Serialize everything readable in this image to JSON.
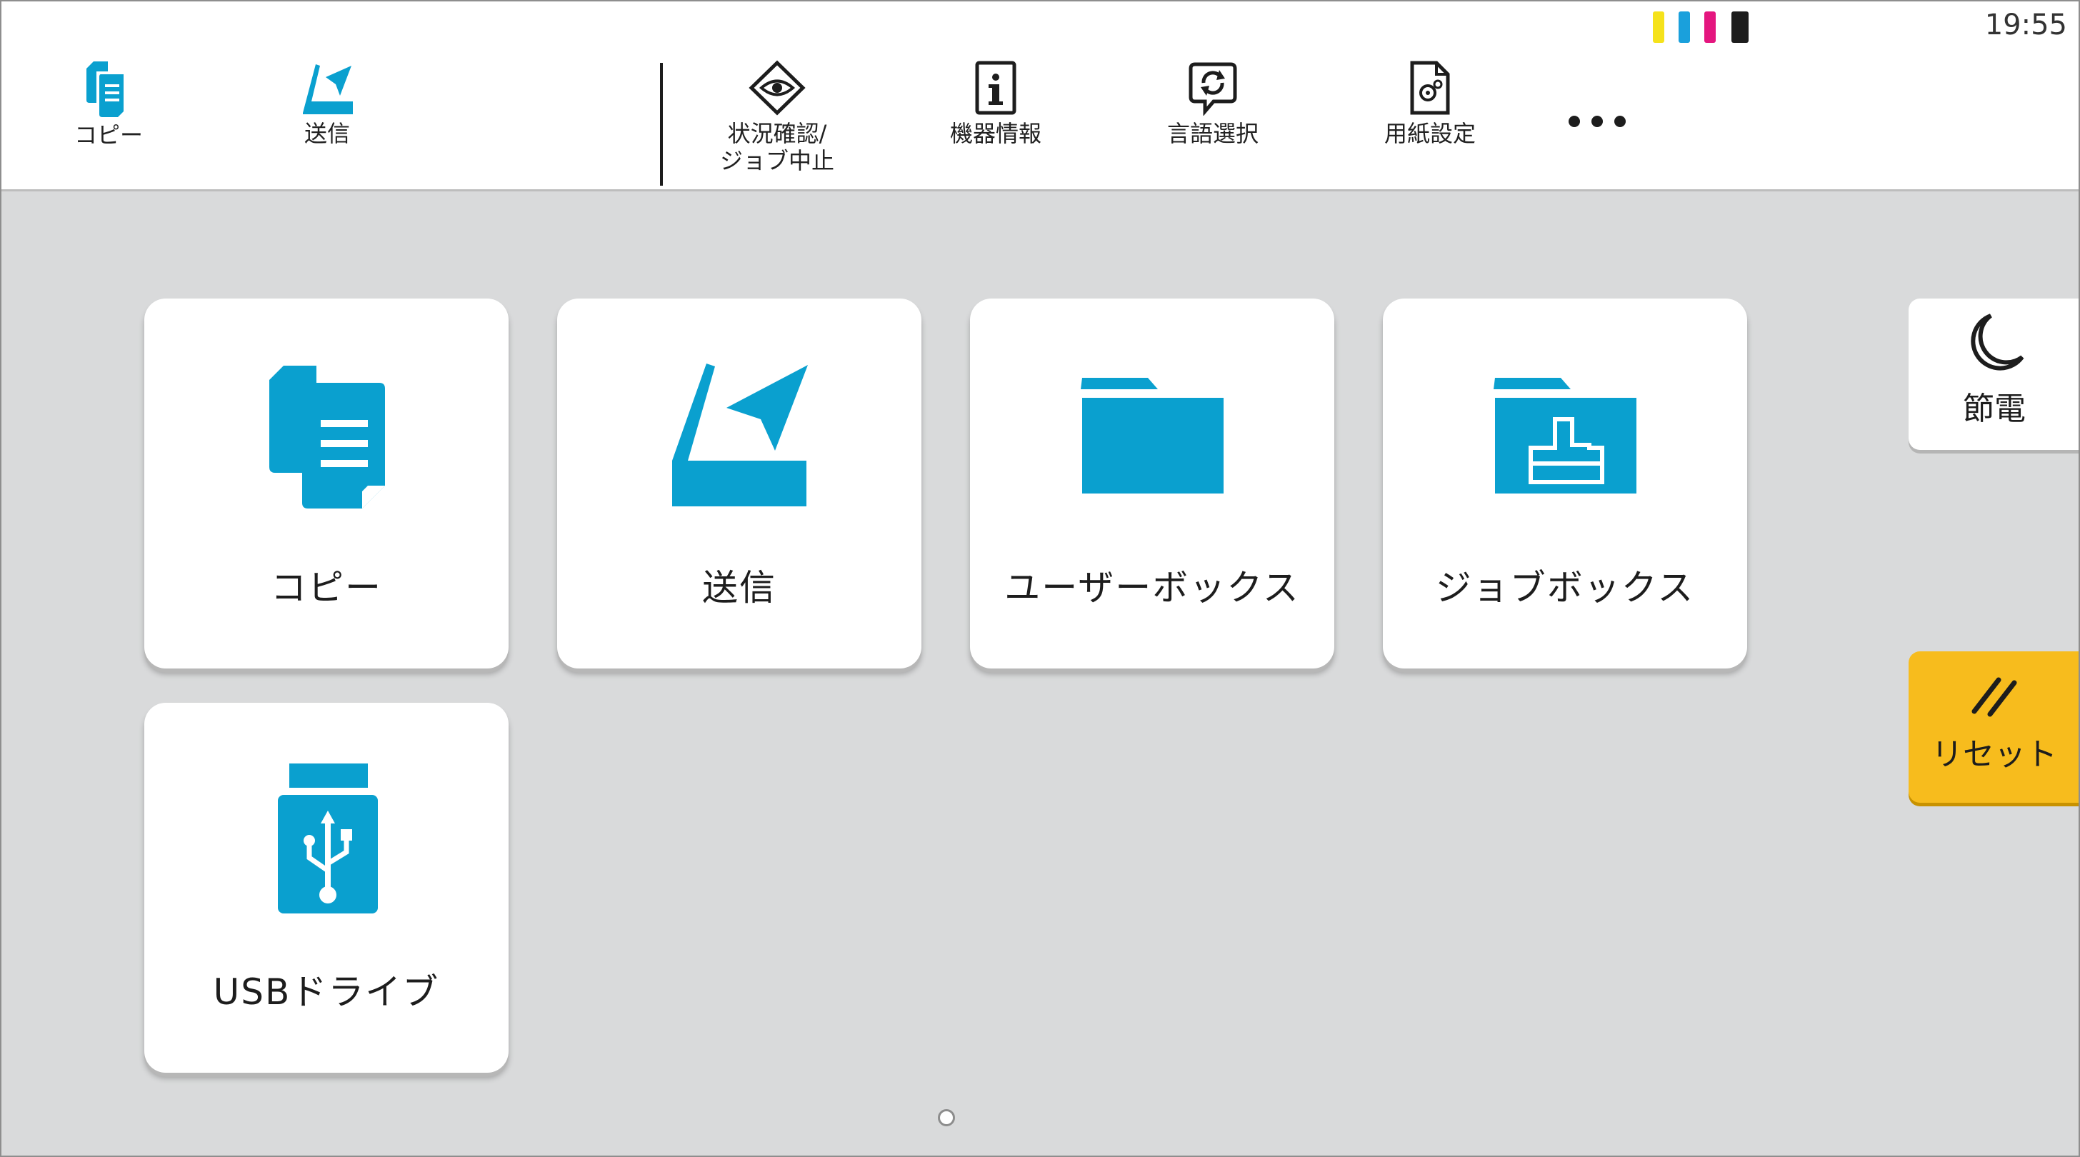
{
  "status": {
    "time": "19:55",
    "toner": [
      "yellow",
      "cyan",
      "magenta",
      "black"
    ]
  },
  "quick": {
    "copy": "コピー",
    "send": "送信",
    "status_line1": "状況確認/",
    "status_line2": "ジョブ中止",
    "device_info": "機器情報",
    "language": "言語選択",
    "paper": "用紙設定"
  },
  "tiles": {
    "copy": "コピー",
    "send": "送信",
    "user_box": "ユーザーボックス",
    "job_box": "ジョブボックス",
    "usb": "USBドライブ"
  },
  "side": {
    "sleep": "節電",
    "reset": "リセット"
  },
  "colors": {
    "accent": "#0aa0cf",
    "reset": "#f7bc1d",
    "background": "#d9dadb"
  }
}
